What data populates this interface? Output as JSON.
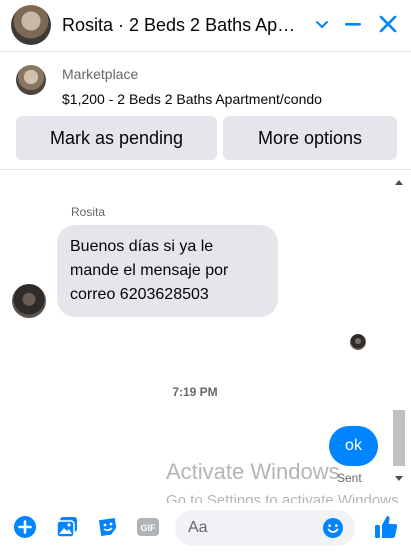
{
  "header": {
    "title": "Rosita · 2 Beds 2 Baths Ap…",
    "icons": [
      "chevron-down-icon",
      "minimize-icon",
      "close-icon"
    ],
    "accent_color": "#0084ff"
  },
  "marketplace": {
    "label": "Marketplace",
    "listing": "$1,200 - 2 Beds 2 Baths Apartment/condo",
    "buttons": {
      "pending": "Mark as pending",
      "more": "More options"
    }
  },
  "conversation": {
    "sender_name": "Rosita",
    "incoming_message": "Buenos días si ya le mande el mensaje por correo 6203628503",
    "timestamp": "7:19 PM",
    "outgoing_message": "ok",
    "status": "Sent"
  },
  "watermark": {
    "line1": "Activate Windows",
    "line2": "Go to Settings to activate Windows"
  },
  "composer": {
    "placeholder": "Aa",
    "gif_label": "GIF",
    "icons": [
      "plus-icon",
      "photo-icon",
      "sticker-icon",
      "gif-icon",
      "emoji-icon",
      "thumbs-up-icon"
    ]
  }
}
